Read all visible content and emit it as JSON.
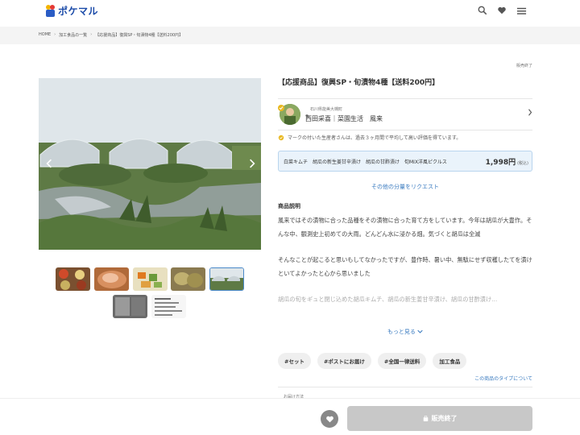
{
  "header": {
    "logo_text": "ポケマル",
    "icons": [
      "search-icon",
      "heart-icon",
      "menu-icon"
    ]
  },
  "breadcrumb": {
    "items": [
      "HOME",
      "加工食品の一覧",
      "【応援商品】復興SP・旬漬物4種【送料200円】"
    ]
  },
  "product": {
    "status_top": "販売終了",
    "title": "【応援商品】復興SP・旬漬物4種【送料200円】"
  },
  "seller": {
    "location": "石川県能美大槻町",
    "name": "西田采喜｜菜園生活　風来"
  },
  "notice": "マークの付いた生産者さんは、過去３ヶ月間で平均して高い評価を得ています。",
  "variant": {
    "label": "白菜キムチ　胡瓜の新生姜甘辛漬け　胡瓜の甘酢漬け　旬MIX洋風ピクルス",
    "price": "1,998円",
    "tax_note": "(税込)"
  },
  "request_link": "その他の分量をリクエスト",
  "description": {
    "heading": "商品説明",
    "paragraphs": [
      "風来ではその漬物に合った品種をその漬物に合った育て方をしています。今年は胡瓜が大豊作。そんな中、観測史上初めての大雨。どんどん水に浸かる畑。気づくと胡瓜は全滅",
      "そんなことが起こると思いもしてなかったですが、豊作時、暑い中、無駄にせず収穫したてを漬けといてよかったと心から思いました",
      "胡瓜の旬をギュと閉じ込めた胡瓜キムチ、胡瓜の新生姜甘辛漬け、胡瓜の甘酢漬け…"
    ],
    "more_link": "もっと見る"
  },
  "tags": [
    "#セット",
    "#ポストにお届け",
    "#全国一律送料",
    "加工食品"
  ],
  "type_link": "この商品のタイプについて",
  "partial_label": "お届け方法",
  "footer": {
    "sold_out_label": "販売終了"
  },
  "colors": {
    "accent": "#3a7bc0",
    "logo": "#1a4aa8",
    "variant_bg": "#eaf3fb",
    "sold_button": "#c8c8c8"
  }
}
